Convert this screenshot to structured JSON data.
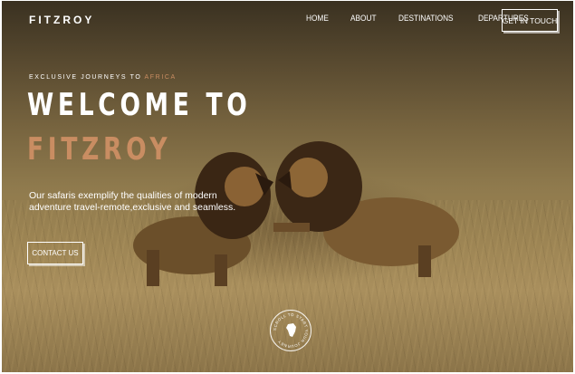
{
  "brand": {
    "name": "FITZROY"
  },
  "nav": {
    "items": [
      {
        "label": "HOME"
      },
      {
        "label": "ABOUT"
      },
      {
        "label": "DESTINATIONS"
      },
      {
        "label": "DEPARTURES"
      }
    ],
    "cta_label": "GET IN TOUCH"
  },
  "hero": {
    "eyebrow_prefix": "EXCLUSIVE JOURNEYS TO ",
    "eyebrow_accent": "AFRICA",
    "headline_line1": "WELCOME TO",
    "headline_line2": "FITZROY",
    "description": "Our safaris exemplify the qualities of modern adventure travel-remote,exclusive and seamless.",
    "cta_label": "CONTACT US",
    "badge_text": "SCROLL TO START YOUR JOURNEY",
    "accent_color": "#c98d62"
  }
}
